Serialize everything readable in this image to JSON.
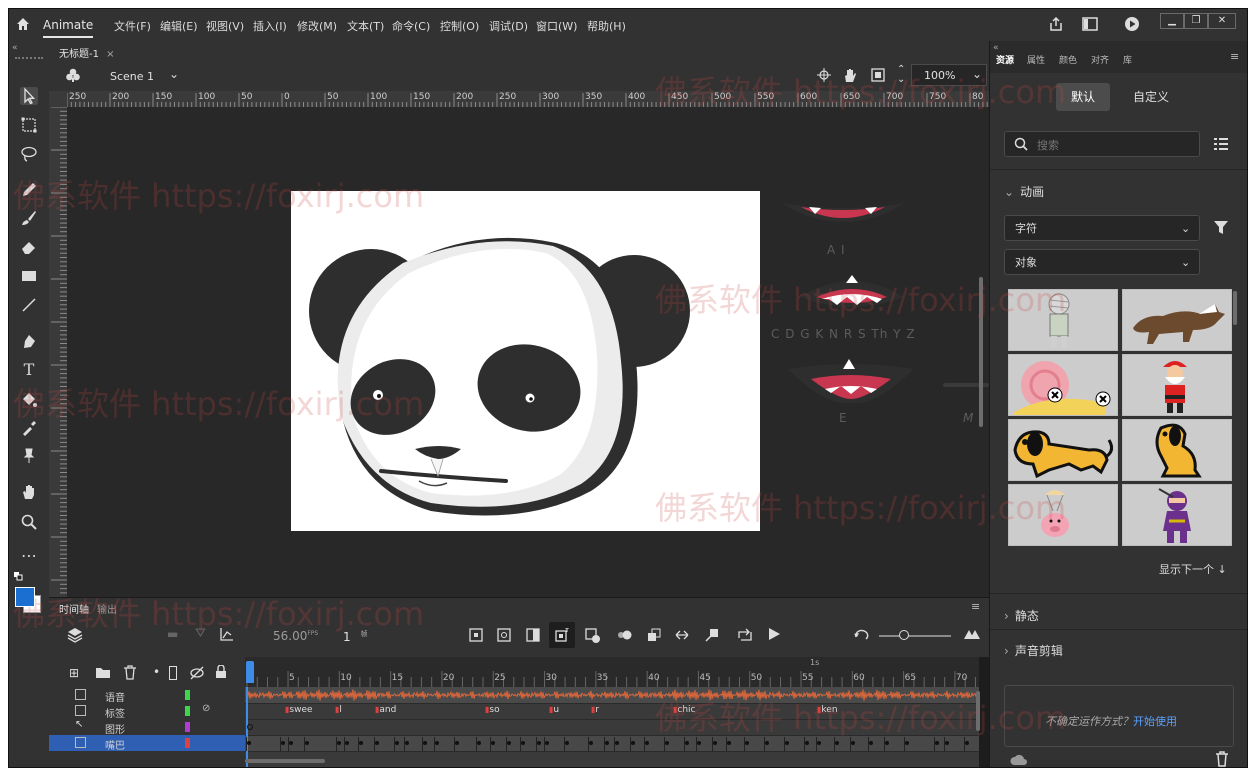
{
  "app": {
    "name": "Animate"
  },
  "menu": [
    "文件(F)",
    "编辑(E)",
    "视图(V)",
    "插入(I)",
    "修改(M)",
    "文本(T)",
    "命令(C)",
    "控制(O)",
    "调试(D)",
    "窗口(W)",
    "帮助(H)"
  ],
  "document": {
    "tab_title": "无标题-1",
    "tab_close": "×",
    "scene": "Scene 1",
    "zoom": "100%"
  },
  "ruler": {
    "labels": [
      "250",
      "200",
      "150",
      "100",
      "50",
      "0",
      "50",
      "100",
      "150",
      "200",
      "250",
      "300",
      "350",
      "400",
      "450",
      "500",
      "550",
      "600",
      "650",
      "700",
      "750",
      "80"
    ]
  },
  "stage_labels": {
    "ai": "A I",
    "cdg": "C D G K N R S Th Y Z",
    "e": "E",
    "m": "M"
  },
  "timeline": {
    "tabs": [
      "时间轴",
      "输出"
    ],
    "fps": "56.00",
    "fps_unit": "FPS",
    "frame": "1",
    "frame_unit": "帧",
    "seconds_marker": "1s",
    "frame_numbers": [
      "5",
      "10",
      "15",
      "20",
      "25",
      "30",
      "35",
      "40",
      "45",
      "50",
      "55",
      "60",
      "65",
      "70"
    ],
    "layers": [
      {
        "name": "语音",
        "color": "#3bd64a",
        "selected": false
      },
      {
        "name": "标签",
        "color": "#3bd64a",
        "selected": false
      },
      {
        "name": "图形",
        "color": "#b23bd6",
        "selected": false
      },
      {
        "name": "嘴巴",
        "color": "#e04040",
        "selected": true
      }
    ],
    "frame_labels": [
      "swee",
      "l",
      "and",
      "so",
      "u",
      "r",
      "chic",
      "ken"
    ]
  },
  "right_panel": {
    "tabs": [
      "资源",
      "属性",
      "颜色",
      "对齐",
      "库"
    ],
    "toggle": [
      "默认",
      "自定义"
    ],
    "search_placeholder": "搜索",
    "section_animation": "动画",
    "dropdown1": "字符",
    "dropdown2": "对象",
    "show_next": "显示下一个",
    "section_static": "静态",
    "section_sound": "声音剪辑",
    "help_text": "不确定运作方式？",
    "help_link": "开始使用"
  },
  "watermark": "佛系软件 https://foxirj.com",
  "colors": {
    "fill": "#1a6fd1",
    "stroke": "#222222",
    "accent": "#2d72d9",
    "wave": "#e0673a"
  }
}
